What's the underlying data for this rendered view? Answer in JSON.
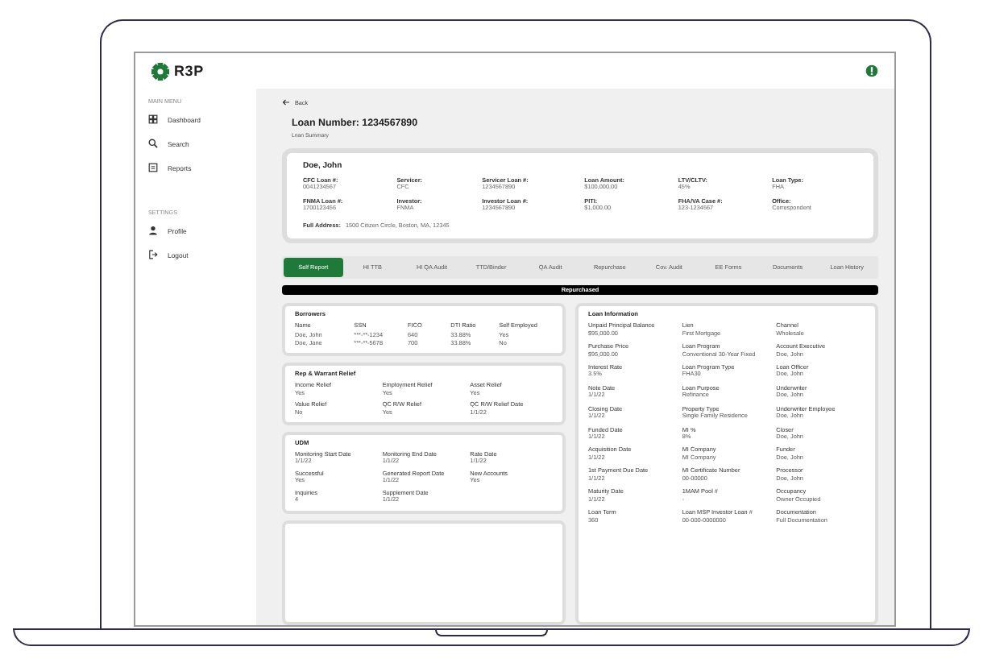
{
  "header": {
    "logo_text": "R3P"
  },
  "sidebar": {
    "sections": [
      {
        "heading": "MAIN MENU",
        "items": [
          {
            "label": "Dashboard"
          },
          {
            "label": "Search"
          },
          {
            "label": "Reports"
          }
        ]
      },
      {
        "heading": "SETTINGS",
        "items": [
          {
            "label": "Profile"
          },
          {
            "label": "Logout"
          }
        ]
      }
    ]
  },
  "back": "Back",
  "title": "Loan Number: 1234567890",
  "subtitle": "Loan Summary",
  "summary": {
    "name": "Doe, John",
    "fields": [
      {
        "label": "CFC Loan #:",
        "value": "0041234567"
      },
      {
        "label": "Servicer:",
        "value": "CFC"
      },
      {
        "label": "Servicer Loan #:",
        "value": "1234567890"
      },
      {
        "label": "Loan Amount:",
        "value": "$100,000.00"
      },
      {
        "label": "LTV/CLTV:",
        "value": "45%"
      },
      {
        "label": "Loan Type:",
        "value": "FHA"
      },
      {
        "label": "FNMA Loan #:",
        "value": "1700123456"
      },
      {
        "label": "Investor:",
        "value": "FNMA"
      },
      {
        "label": "Investor Loan #:",
        "value": "1234567890"
      },
      {
        "label": "PITI:",
        "value": "$1,000.00"
      },
      {
        "label": "FHA/VA Case #:",
        "value": "123-1234567"
      },
      {
        "label": "Office:",
        "value": "Correspondent"
      }
    ],
    "address_label": "Full Address:",
    "address": "1500 Citizen Circle, Boston, MA, 12345"
  },
  "tabs": [
    {
      "label": "Self Report",
      "selected": true
    },
    {
      "label": "HI TTB",
      "selected": false
    },
    {
      "label": "HI QA Audit",
      "selected": false
    },
    {
      "label": "TTD/Binder",
      "selected": false
    },
    {
      "label": "QA Audit",
      "selected": false
    },
    {
      "label": "Repurchase",
      "selected": false
    },
    {
      "label": "Cov. Audit",
      "selected": false
    },
    {
      "label": "EE Forms",
      "selected": false
    },
    {
      "label": "Documents",
      "selected": false
    },
    {
      "label": "Loan History",
      "selected": false
    }
  ],
  "status_banner": "Repurchased",
  "borrowers": {
    "title": "Borrowers",
    "columns": [
      "Name",
      "SSN",
      "FICO",
      "DTI Ratio",
      "Self Employed"
    ],
    "rows": [
      [
        "Doe, John",
        "***-**-1234",
        "640",
        "33.88%",
        "Yes"
      ],
      [
        "Doe, Jane",
        "***-**-5678",
        "700",
        "33.88%",
        "No"
      ]
    ]
  },
  "panels": [
    {
      "title": "Rep & Warrant Relief",
      "fields": [
        {
          "label": "Income Relief",
          "value": "Yes"
        },
        {
          "label": "Employment Relief",
          "value": "Yes"
        },
        {
          "label": "Asset Relief",
          "value": "Yes"
        },
        {
          "label": "Value Relief",
          "value": "No"
        },
        {
          "label": "QC R/W Relief",
          "value": "Yes"
        },
        {
          "label": "QC R/W Relief Date",
          "value": "1/1/22"
        }
      ]
    },
    {
      "title": "UDM",
      "fields": [
        {
          "label": "Monitoring Start Date",
          "value": "1/1/22"
        },
        {
          "label": "Monitoring End Date",
          "value": "1/1/22"
        },
        {
          "label": "Rate Date",
          "value": "1/1/22"
        },
        {
          "label": "Successful",
          "value": "Yes"
        },
        {
          "label": "Generated Report Date",
          "value": "1/1/22"
        },
        {
          "label": "New Accounts",
          "value": "Yes"
        },
        {
          "label": "Inquiries",
          "value": "4"
        },
        {
          "label": "Supplement Date",
          "value": "1/1/22"
        }
      ]
    }
  ],
  "loan_information": {
    "title": "Loan Information",
    "fields": [
      {
        "label": "Unpaid Principal Balance",
        "value": "$95,000.00"
      },
      {
        "label": "Lien",
        "value": "First Mortgage"
      },
      {
        "label": "Channel",
        "value": "Wholesale"
      },
      {
        "label": "Purchase Price",
        "value": "$95,000.00"
      },
      {
        "label": "Loan Program",
        "value": "Conventional 30-Year Fixed"
      },
      {
        "label": "Account Executive",
        "value": "Doe, John"
      },
      {
        "label": "Interest Rate",
        "value": "3.5%"
      },
      {
        "label": "Loan Program Type",
        "value": "FHA30"
      },
      {
        "label": "Loan Officer",
        "value": "Doe, John"
      },
      {
        "label": "Note Date",
        "value": "1/1/22"
      },
      {
        "label": "Loan Purpose",
        "value": "Refinance"
      },
      {
        "label": "Underwriter",
        "value": "Doe, John"
      },
      {
        "label": "Closing Date",
        "value": "1/1/22"
      },
      {
        "label": "Property Type",
        "value": "Single Family Residence"
      },
      {
        "label": "Underwriter Employee",
        "value": "Doe, John"
      },
      {
        "label": "Funded Date",
        "value": "1/1/22"
      },
      {
        "label": "MI %",
        "value": "8%"
      },
      {
        "label": "Closer",
        "value": "Doe, John"
      },
      {
        "label": "Acquisition Date",
        "value": "1/1/22"
      },
      {
        "label": "MI Company",
        "value": "MI Company"
      },
      {
        "label": "Funder",
        "value": "Doe, John"
      },
      {
        "label": "1st Payment Due Date",
        "value": "1/1/22"
      },
      {
        "label": "MI Certificate Number",
        "value": "00-00000"
      },
      {
        "label": "Processor",
        "value": "Doe, John"
      },
      {
        "label": "Maturity Date",
        "value": "1/1/22"
      },
      {
        "label": "1MAM Pool #",
        "value": "-"
      },
      {
        "label": "Occupancy",
        "value": "Owner Occupied"
      },
      {
        "label": "Loan Term",
        "value": "360"
      },
      {
        "label": "Loan MSP Investor Loan #",
        "value": "00-000-0000000"
      },
      {
        "label": "Documentation",
        "value": "Full Documentation"
      }
    ]
  }
}
